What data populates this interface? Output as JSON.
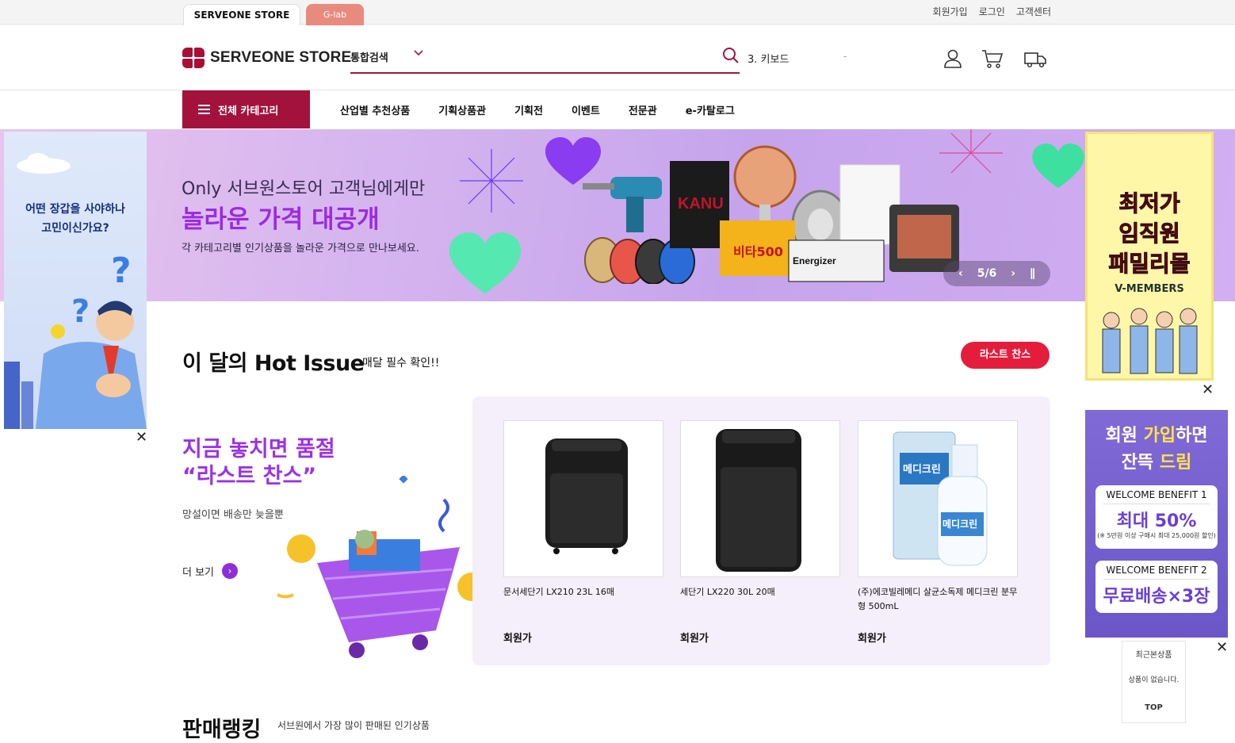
{
  "top": {
    "tabs": [
      "SERVEONE STORE",
      "G-lab"
    ],
    "links": [
      "회원가입",
      "로그인",
      "고객센터"
    ]
  },
  "header": {
    "logo_text": "SERVEONE STORE",
    "search_category": "통합검색",
    "search_keyword": "3. 키보드",
    "search_dot": "-"
  },
  "nav": {
    "category_button": "전체 카테고리",
    "items": [
      "산업별 추천상품",
      "기획상품관",
      "기획전",
      "이벤트",
      "전문관",
      "e-카탈로그"
    ]
  },
  "banner": {
    "line1": "Only 서브원스토어 고객님에게만",
    "line2": "놀라운 가격 대공개",
    "line3": "각 카테고리별 인기상품을 놀라운 가격으로 만나보세요.",
    "pager": "5/6",
    "product_labels": [
      "비타500",
      "Energizer",
      "KANU"
    ]
  },
  "ad_left": {
    "text": "어떤 장갑을 사야하나\n고민이신가요?"
  },
  "ad_right1": {
    "line1": "최저가",
    "line2": "임직원",
    "line3": "패밀리몰",
    "brand": "V-MEMBERS"
  },
  "ad_right2": {
    "head1_pre": "회원 ",
    "head1_hi": "가입",
    "head1_post": "하면",
    "head2_pre": "잔뜩 ",
    "head2_hi": "드림",
    "benefit1_title": "WELCOME BENEFIT 1",
    "benefit1_value": "최대 50%",
    "benefit1_note": "(※ 5만원 이상 구매시 최대 25,000원 할인)",
    "benefit2_title": "WELCOME BENEFIT 2",
    "benefit2_value": "무료배송×3장"
  },
  "recent": {
    "title": "최근본상품",
    "empty": "상품이 없습니다.",
    "top": "TOP"
  },
  "hot_issue": {
    "title": "이 달의 Hot Issue",
    "subtitle": "매달 필수 확인!!",
    "button": "라스트 찬스",
    "promo_heading": "지금 놓치면 품절\n“라스트 찬스”",
    "promo_sub": "망설이면 배송만 늦을뿐",
    "more": "더 보기",
    "products": [
      {
        "name": "문서세단기 LX210 23L 16매",
        "price": "회원가"
      },
      {
        "name": "세단기 LX220 30L 20매",
        "price": "회원가"
      },
      {
        "name": "(주)에코빌레메디 살균소독제 메디크린 분무형 500mL",
        "price": "회원가",
        "label": "메디크린"
      }
    ]
  },
  "ranking": {
    "title": "판매랭킹",
    "subtitle": "서브원에서 가장 많이 판매된 인기상품"
  },
  "colors": {
    "brand": "#a3123c",
    "accent_purple": "#9b32e6",
    "cta_red": "#e51d3c"
  }
}
